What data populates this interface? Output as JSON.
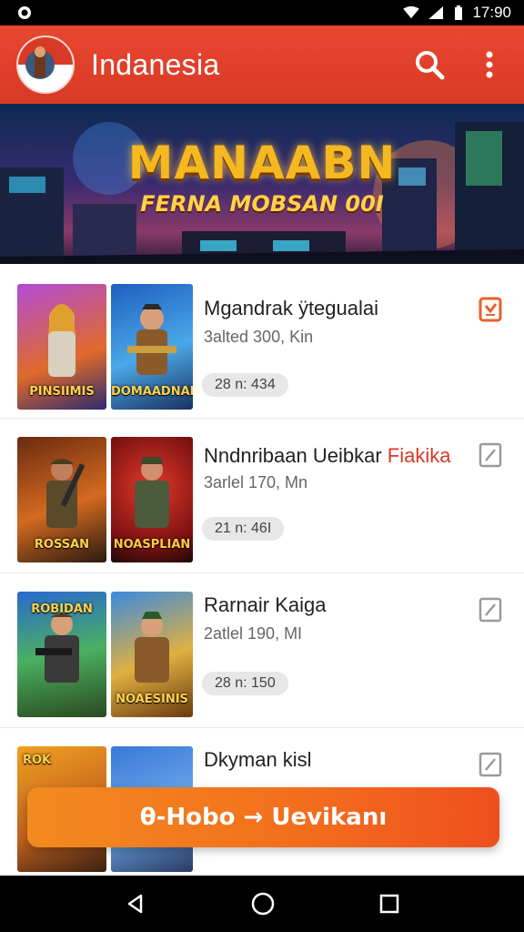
{
  "status_bar": {
    "time": "17:90"
  },
  "app_bar": {
    "title": "Indanesia"
  },
  "banner": {
    "title": "MANAABN",
    "subtitle": "FERNA MOBSAN 00I"
  },
  "items": [
    {
      "title": "Mgandrak ÿtegualai",
      "subtitle": "3alted 300, Kin",
      "chip": "28 n: 434",
      "thumb1_label": "PINSIIMIS",
      "thumb2_label": "DOMAADNAN",
      "action_active": true
    },
    {
      "title_main": "Nndnribaan Ueibkar ",
      "title_red": "Fiakika",
      "subtitle": "3arlel 170, Mn",
      "chip": "21 n: 46I",
      "thumb1_label": "ROSSAN",
      "thumb2_label": "NOASPLIAN",
      "action_active": false
    },
    {
      "title": "Rarnair Kaiga",
      "subtitle": "2atlel 190, MI",
      "chip": "28 n: 150",
      "thumb1_label": "ROBIDAN",
      "thumb2_label": "NOAESINIS",
      "action_active": false
    },
    {
      "title": "Dkyman kisl",
      "thumb1_label": "ROK",
      "action_active": false
    }
  ],
  "cta": {
    "label": "θ-Hobo → Uevikanı"
  }
}
